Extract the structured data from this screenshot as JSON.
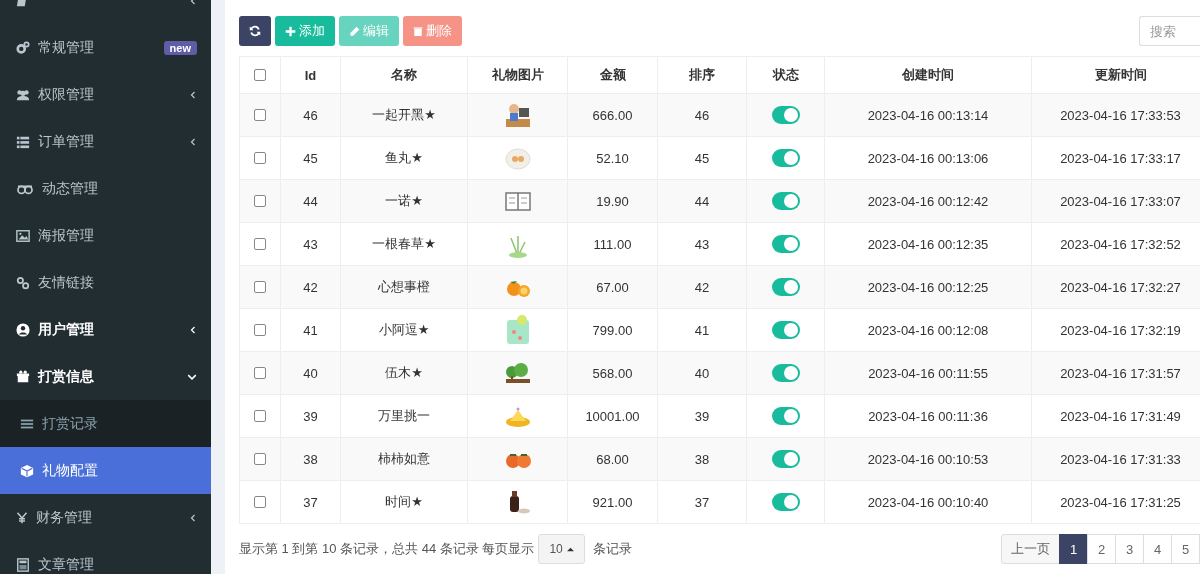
{
  "sidebar": {
    "items": [
      {
        "kind": "item",
        "expanded": false,
        "bold": false,
        "selected": false
      },
      {
        "label": "常规管理",
        "kind": "item",
        "badge": "new",
        "bold": false,
        "selected": false
      },
      {
        "label": "权限管理",
        "kind": "item",
        "expanded": false,
        "bold": false,
        "selected": false
      },
      {
        "label": "订单管理",
        "kind": "item",
        "expanded": false,
        "bold": false,
        "selected": false
      },
      {
        "label": "动态管理",
        "kind": "item",
        "bold": false,
        "selected": false
      },
      {
        "label": "海报管理",
        "kind": "item",
        "bold": false,
        "selected": false
      },
      {
        "label": "友情链接",
        "kind": "item",
        "bold": false,
        "selected": false
      },
      {
        "label": "用户管理",
        "kind": "item",
        "expanded": false,
        "bold": true,
        "selected": false
      },
      {
        "label": "打赏信息",
        "kind": "item",
        "expanded": true,
        "bold": true,
        "selected": false
      },
      {
        "label": "打赏记录",
        "kind": "sub",
        "bold": false,
        "selected": false
      },
      {
        "label": "礼物配置",
        "kind": "sub",
        "bold": false,
        "selected": true
      },
      {
        "label": "财务管理",
        "kind": "item",
        "expanded": false,
        "bold": false,
        "selected": false
      },
      {
        "label": "文章管理",
        "kind": "item",
        "bold": false,
        "selected": false
      }
    ]
  },
  "toolbar": {
    "buttons": [
      {
        "kind": "refresh",
        "disabled": false
      },
      {
        "kind": "add",
        "label": "添加",
        "disabled": false
      },
      {
        "kind": "edit",
        "label": "编辑",
        "disabled": true
      },
      {
        "kind": "delete",
        "label": "删除",
        "disabled": true
      }
    ],
    "search": {
      "placeholder": "搜索"
    }
  },
  "table": {
    "header_checkbox": {
      "checked": false
    },
    "columns": [
      "Id",
      "名称",
      "礼物图片",
      "金额",
      "排序",
      "状态",
      "创建时间",
      "更新时间"
    ],
    "rows": [
      {
        "checked": false,
        "id": "46",
        "name": "一起开黑★",
        "amount": "666.00",
        "sort": "46",
        "on": true,
        "created": "2023-04-16 00:13:14",
        "updated": "2023-04-16 17:33:53"
      },
      {
        "checked": false,
        "id": "45",
        "name": "鱼丸★",
        "amount": "52.10",
        "sort": "45",
        "on": true,
        "created": "2023-04-16 00:13:06",
        "updated": "2023-04-16 17:33:17"
      },
      {
        "checked": false,
        "id": "44",
        "name": "一诺★",
        "amount": "19.90",
        "sort": "44",
        "on": true,
        "created": "2023-04-16 00:12:42",
        "updated": "2023-04-16 17:33:07"
      },
      {
        "checked": false,
        "id": "43",
        "name": "一根春草★",
        "amount": "111.00",
        "sort": "43",
        "on": true,
        "created": "2023-04-16 00:12:35",
        "updated": "2023-04-16 17:32:52"
      },
      {
        "checked": false,
        "id": "42",
        "name": "心想事橙",
        "amount": "67.00",
        "sort": "42",
        "on": true,
        "created": "2023-04-16 00:12:25",
        "updated": "2023-04-16 17:32:27"
      },
      {
        "checked": false,
        "id": "41",
        "name": "小阿逗★",
        "amount": "799.00",
        "sort": "41",
        "on": true,
        "created": "2023-04-16 00:12:08",
        "updated": "2023-04-16 17:32:19"
      },
      {
        "checked": false,
        "id": "40",
        "name": "伍木★",
        "amount": "568.00",
        "sort": "40",
        "on": true,
        "created": "2023-04-16 00:11:55",
        "updated": "2023-04-16 17:31:57"
      },
      {
        "checked": false,
        "id": "39",
        "name": "万里挑一",
        "amount": "10001.00",
        "sort": "39",
        "on": true,
        "created": "2023-04-16 00:11:36",
        "updated": "2023-04-16 17:31:49"
      },
      {
        "checked": false,
        "id": "38",
        "name": "柿柿如意",
        "amount": "68.00",
        "sort": "38",
        "on": true,
        "created": "2023-04-16 00:10:53",
        "updated": "2023-04-16 17:31:33"
      },
      {
        "checked": false,
        "id": "37",
        "name": "时间★",
        "amount": "921.00",
        "sort": "37",
        "on": true,
        "created": "2023-04-16 00:10:40",
        "updated": "2023-04-16 17:31:25"
      }
    ]
  },
  "footer": {
    "summary": "显示第 1 到第 10 条记录，总共 44 条记录 每页显示",
    "page_size": "10",
    "suffix": "条记录",
    "pages": [
      {
        "label": "上一页",
        "selected": false
      },
      {
        "label": "1",
        "selected": true
      },
      {
        "label": "2",
        "selected": false
      },
      {
        "label": "3",
        "selected": false
      },
      {
        "label": "4",
        "selected": false
      },
      {
        "label": "5",
        "selected": false
      }
    ]
  }
}
